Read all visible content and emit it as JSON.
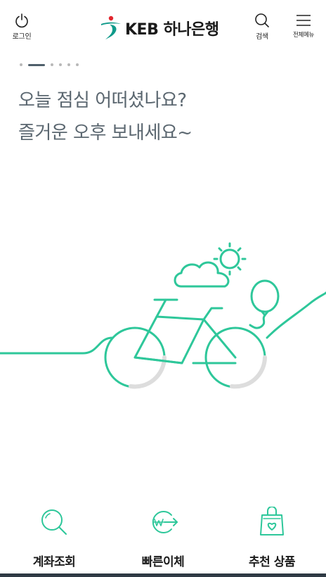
{
  "header": {
    "login_label": "로그인",
    "logo_text": "KEB 하나은행",
    "search_label": "검색",
    "menu_label": "전체메뉴"
  },
  "pager": {
    "total": 6,
    "active_index": 1
  },
  "greeting": {
    "line1": "오늘 점심 어떠셨나요?",
    "line2": "즐거운 오후 보내세요~"
  },
  "bottom_menu": {
    "items": [
      {
        "label": "계좌조회",
        "icon": "magnifier-icon"
      },
      {
        "label": "빠른이체",
        "icon": "quick-transfer-icon"
      },
      {
        "label": "추천 상품",
        "icon": "shopping-bag-heart-icon"
      }
    ]
  },
  "colors": {
    "accent": "#2ec79a",
    "text_gray": "#5b6770",
    "logo_green": "#0f9a8a",
    "logo_red": "#e2262e"
  }
}
